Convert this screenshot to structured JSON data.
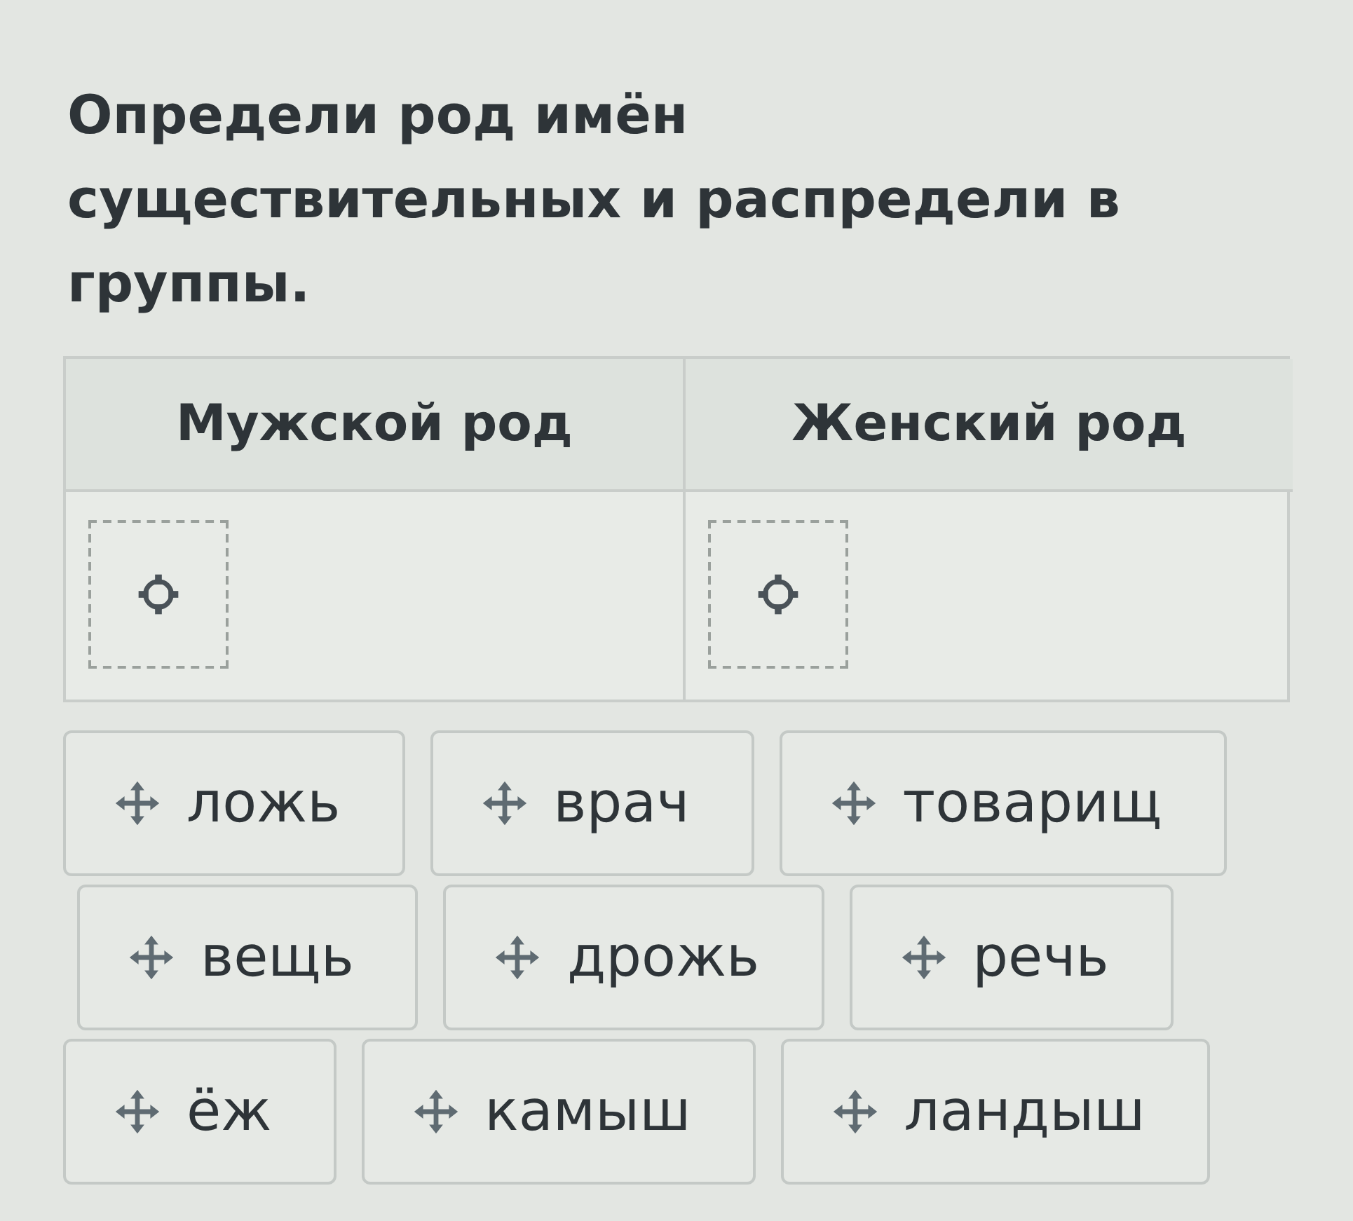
{
  "instruction": "Определи род имён существительных и распредели в группы.",
  "groups": [
    {
      "heading": "Мужской род"
    },
    {
      "heading": "Женский род"
    }
  ],
  "word_rows": [
    [
      "ложь",
      "врач",
      "товарищ"
    ],
    [
      "вещь",
      "дрожь",
      "речь"
    ],
    [
      "ёж",
      "камыш",
      "ландыш"
    ]
  ]
}
